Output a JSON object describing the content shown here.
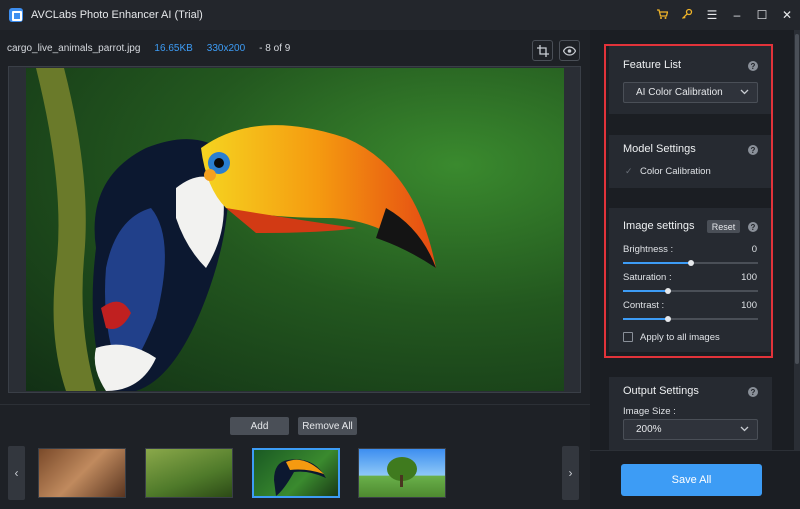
{
  "app": {
    "title": "AVCLabs Photo Enhancer AI (Trial)"
  },
  "titlebar_icons": [
    "cart-icon",
    "key-icon",
    "menu-icon",
    "minimize-icon",
    "maximize-icon",
    "close-icon"
  ],
  "file_info": {
    "filename": "cargo_live_animals_parrot.jpg",
    "size": "16.65KB",
    "dimensions": "330x200",
    "position": "- 8 of 9"
  },
  "thumb_actions": {
    "add_label": "Add",
    "remove_all_label": "Remove All"
  },
  "feature_list": {
    "title": "Feature List",
    "selected": "AI Color Calibration"
  },
  "model_settings": {
    "title": "Model Settings",
    "option_label": "Color Calibration",
    "option_checked": true
  },
  "image_settings": {
    "title": "Image settings",
    "reset_label": "Reset",
    "sliders": [
      {
        "label": "Brightness :",
        "value": "0",
        "level": 0.5
      },
      {
        "label": "Saturation :",
        "value": "100",
        "level": 0.33
      },
      {
        "label": "Contrast :",
        "value": "100",
        "level": 0.33
      }
    ],
    "apply_all_label": "Apply to all images",
    "apply_all_checked": false
  },
  "output_settings": {
    "title": "Output Settings",
    "image_size_label": "Image Size :",
    "image_size_value": "200%"
  },
  "save_all_label": "Save All",
  "colors": {
    "accent": "#3d9cf5",
    "highlight": "#e2333a",
    "background": "#1e2126"
  }
}
